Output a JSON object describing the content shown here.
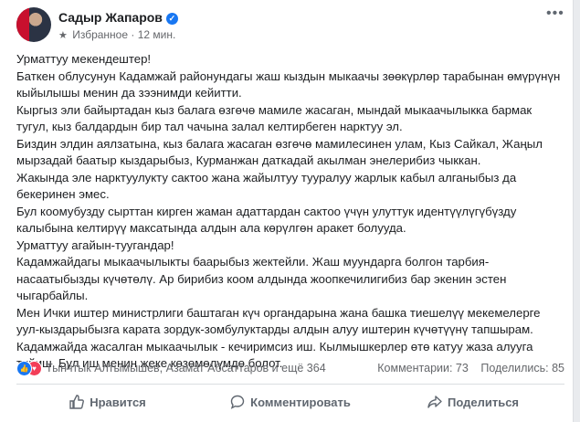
{
  "author": {
    "name": "Садыр Жапаров",
    "verified_icon": "verified-badge-icon",
    "audience_icon": "star-icon",
    "audience": "Избранное",
    "time": "12 мин."
  },
  "menu_icon": "more-options-icon",
  "body": [
    "Урматтуу мекендештер!",
    "Баткен облусунун Кадамжай районундагы жаш кыздын мыкаачы зөөкүрлөр тарабынан өмүрүнүн кыйылышы менин да зээнимди кейитти.",
    "Кыргыз эли байыртадан кыз балага өзгөчө мамиле жасаган, мындай мыкаачылыкка бармак тугул, кыз балдардын бир тал чачына залал келтирбеген нарктуу эл.",
    "Биздин элдин аялзатына, кыз балага жасаган өзгөчө мамилесинен улам, Кыз Сайкал, Жаңыл мырзадай баатыр кыздарыбыз, Курманжан даткадай акылман энелерибиз чыккан.",
    "Жакында эле нарктуулукту сактоо жана жайылтуу тууралуу жарлык кабыл алганыбыз да бекеринен эмес.",
    "Бул коомубузду сырттан кирген жаман адаттардан сактоо үчүн улуттук идентүүлүгүбүзду калыбына келтирүү максатында алдын ала көрүлгөн аракет болууда.",
    "Урматтуу агайын-туугандар!",
    "Кадамжайдагы мыкаачылыкты баарыбыз жектейли. Жаш муундарга болгон тарбия-насаатыбызды күчөтөлү. Ар бирибиз коом алдында жоопкечилигибиз бар экенин эстен чыгарбайлы.",
    "Мен Ички иштер министрлиги баштаган күч органдарына жана башка тиешелүү мекемелерге уул-кыздарыбызга карата зордук-зомбулуктарды алдын алуу иштерин күчөтүүнү тапшырам.",
    "Кадамжайда жасалган мыкаачылык - кечиримсиз иш. Кылмышкерлер өтө катуу жаза алууга тийиш. Бул иш менин жеке көзөмөлүмдө болот."
  ],
  "reactions": {
    "icons": [
      "like-reaction-icon",
      "love-reaction-icon"
    ],
    "summary": "Тынчтык Алтымышев, Азамат Абсаттаров и ещё 364",
    "comments": "Комментарии: 73",
    "shares": "Поделились: 85"
  },
  "actions": {
    "like": "Нравится",
    "comment": "Комментировать",
    "share": "Поделиться"
  },
  "colors": {
    "accent": "#1877f2",
    "love": "#f33e58",
    "text": "#1c1e21",
    "secondary": "#65676b"
  }
}
